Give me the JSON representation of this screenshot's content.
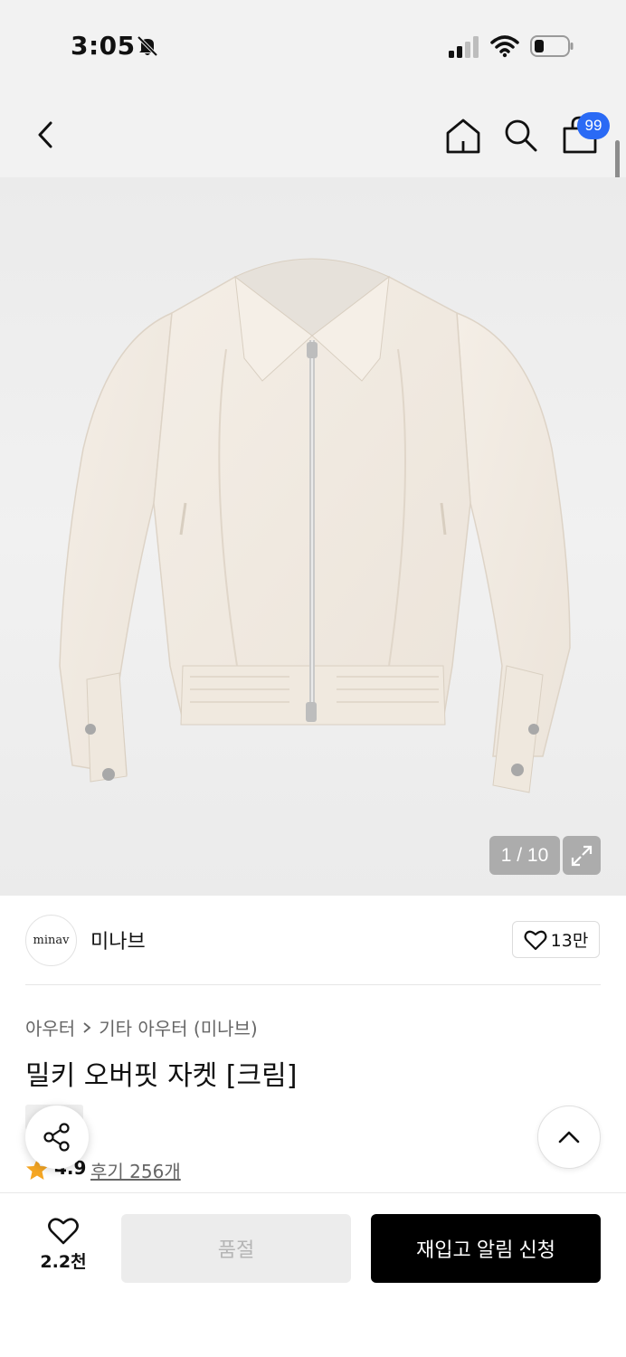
{
  "status_bar": {
    "time": "3:05",
    "icons": [
      "bell-off-icon",
      "signal-icon",
      "wifi-icon",
      "battery-icon"
    ]
  },
  "nav": {
    "cart_badge": "99",
    "icons": [
      "back-icon",
      "home-icon",
      "search-icon",
      "cart-icon"
    ]
  },
  "gallery": {
    "counter": "1 / 10",
    "expand_icon": "expand-icon"
  },
  "brand": {
    "logo_text": "minav",
    "name": "미나브",
    "likes": "13만"
  },
  "breadcrumb": {
    "items": [
      "아우터",
      "기타 아우터 (미나브)"
    ]
  },
  "product": {
    "title": "밀키 오버핏 자켓 [크림]"
  },
  "rating": {
    "value": "4.9",
    "reviews": "후기 256개"
  },
  "bottom_bar": {
    "wish_count": "2.2천",
    "soldout_label": "품절",
    "restock_label": "재입고 알림 신청"
  },
  "colors": {
    "accent": "#2a6af5",
    "star": "#f5a623",
    "primary_button": "#000000"
  }
}
